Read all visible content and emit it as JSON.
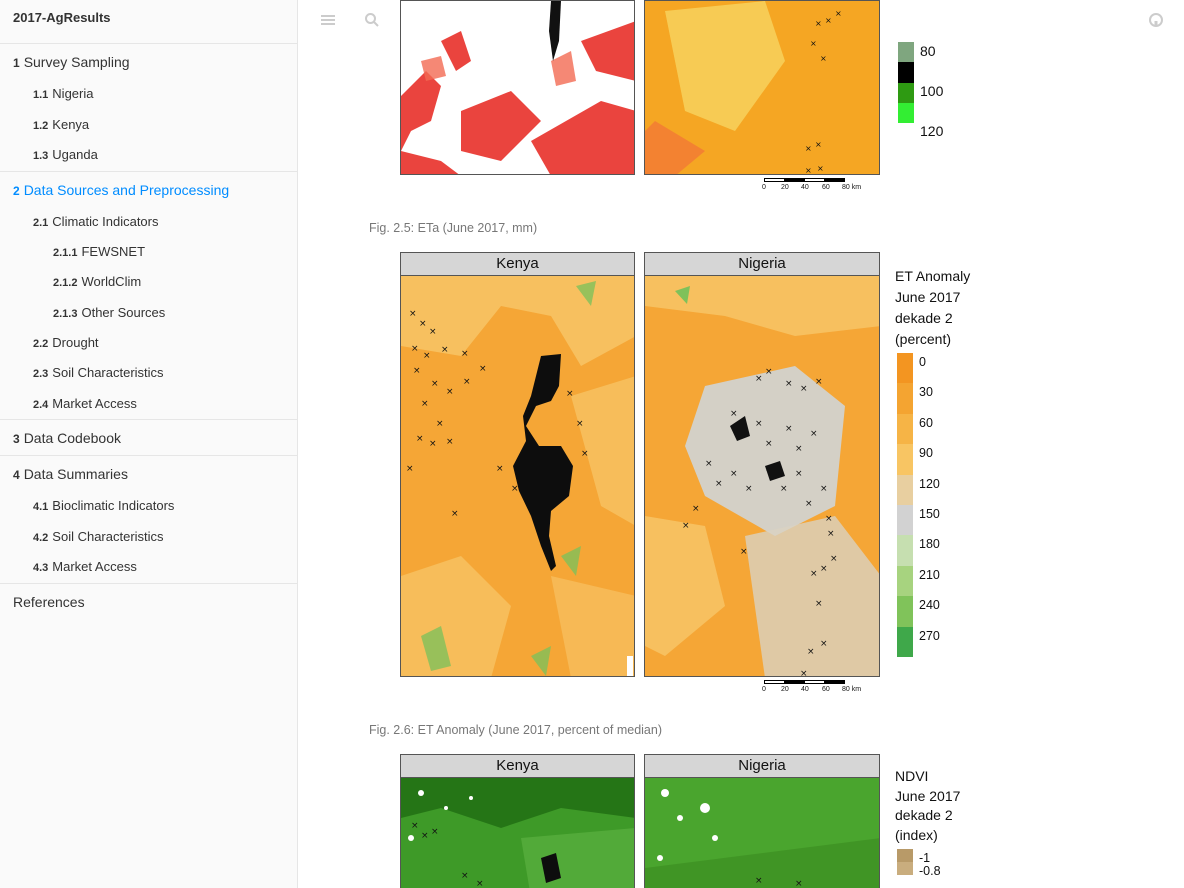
{
  "book": {
    "title": "2017-AgResults"
  },
  "toc": [
    {
      "num": "1",
      "label": "Survey Sampling",
      "level": 1
    },
    {
      "num": "1.1",
      "label": "Nigeria",
      "level": 2
    },
    {
      "num": "1.2",
      "label": "Kenya",
      "level": 2
    },
    {
      "num": "1.3",
      "label": "Uganda",
      "level": 2
    },
    {
      "num": "2",
      "label": "Data Sources and Preprocessing",
      "level": 1,
      "active": true
    },
    {
      "num": "2.1",
      "label": "Climatic Indicators",
      "level": 2
    },
    {
      "num": "2.1.1",
      "label": "FEWSNET",
      "level": 3
    },
    {
      "num": "2.1.2",
      "label": "WorldClim",
      "level": 3
    },
    {
      "num": "2.1.3",
      "label": "Other Sources",
      "level": 3
    },
    {
      "num": "2.2",
      "label": "Drought",
      "level": 2
    },
    {
      "num": "2.3",
      "label": "Soil Characteristics",
      "level": 2
    },
    {
      "num": "2.4",
      "label": "Market Access",
      "level": 2
    },
    {
      "num": "3",
      "label": "Data Codebook",
      "level": 1
    },
    {
      "num": "4",
      "label": "Data Summaries",
      "level": 1
    },
    {
      "num": "4.1",
      "label": "Bioclimatic Indicators",
      "level": 2
    },
    {
      "num": "4.2",
      "label": "Soil Characteristics",
      "level": 2
    },
    {
      "num": "4.3",
      "label": "Market Access",
      "level": 2
    },
    {
      "num": "",
      "label": "References",
      "level": 1
    }
  ],
  "toolbar": {
    "icons": [
      "list-icon",
      "search-icon",
      "font-icon",
      "edit-icon",
      "github-icon"
    ]
  },
  "figure_top": {
    "legend_labels": [
      "80",
      "100",
      "120"
    ],
    "legend_colors": [
      "#7fa67f",
      "#000000",
      "#2e9a12",
      "#33ee33"
    ],
    "scale_labels": [
      "0",
      "20",
      "40",
      "60",
      "80 km"
    ],
    "caption": "Fig. 2.5: ETa (June 2017, mm)"
  },
  "figure_anomaly": {
    "panels": [
      "Kenya",
      "Nigeria"
    ],
    "legend_title": "ET Anomaly\nJune 2017\ndekade 2\n(percent)",
    "legend_labels": [
      "0",
      "30",
      "60",
      "90",
      "120",
      "150",
      "180",
      "210",
      "240",
      "270"
    ],
    "legend_colors": [
      "#f39521",
      "#f4a431",
      "#f6b446",
      "#f8c563",
      "#e8cfa0",
      "#d2d2d2",
      "#c6dfb0",
      "#a7d37f",
      "#80c35a",
      "#3fa84a"
    ],
    "scale_labels": [
      "0",
      "20",
      "40",
      "60",
      "80 km"
    ],
    "caption": "Fig. 2.6: ET Anomaly (June 2017, percent of median)"
  },
  "figure_ndvi": {
    "panels": [
      "Kenya",
      "Nigeria"
    ],
    "legend_title": "NDVI\nJune 2017\ndekade 2\n(index)",
    "legend_labels": [
      "-1",
      "-0.8"
    ],
    "legend_colors": [
      "#b89a68",
      "#c9ad7e"
    ]
  }
}
